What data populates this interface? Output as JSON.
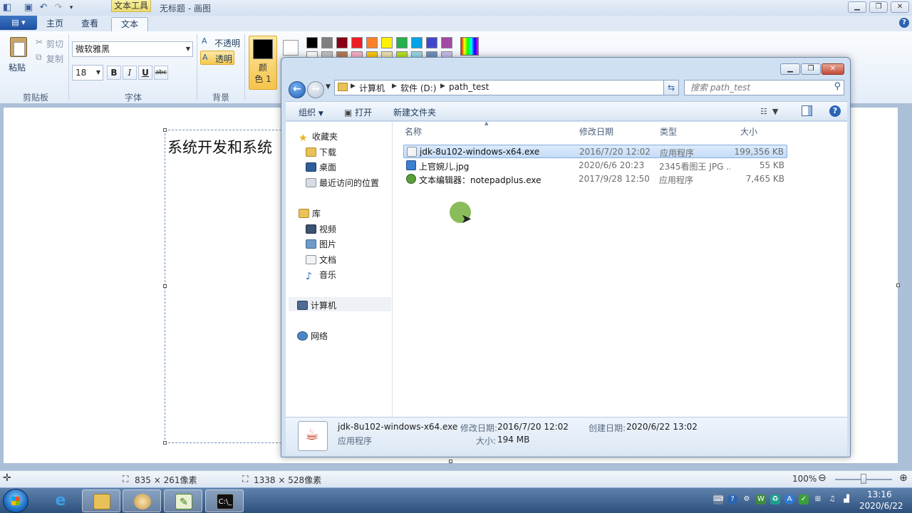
{
  "paint": {
    "title": "无标题 - 画图",
    "context_tab_group": "文本工具",
    "tabs": [
      {
        "label": "主页"
      },
      {
        "label": "查看"
      },
      {
        "label": "文本"
      }
    ],
    "clipboard": {
      "paste": "粘贴",
      "cut": "剪切",
      "copy": "复制",
      "group_label": "剪贴板"
    },
    "font": {
      "family": "微软雅黑",
      "size": "18",
      "bold": "B",
      "italic": "I",
      "underline": "U",
      "strikethrough": "abc",
      "group_label": "字体"
    },
    "background": {
      "opaque": "不透明",
      "transparent": "透明",
      "group_label": "背景"
    },
    "colors": {
      "color1_label_line1": "颜",
      "color1_label_line2": "色 1",
      "palette_row1": [
        "#000000",
        "#7f7f7f",
        "#880015",
        "#ed1c24",
        "#ff7f27",
        "#fff200",
        "#22b14c",
        "#00a2e8",
        "#3f48cc",
        "#a349a4"
      ],
      "palette_row2": [
        "#ffffff",
        "#c3c3c3",
        "#b97a57",
        "#ffaec9",
        "#ffc90e",
        "#efe4b0",
        "#b5e61d",
        "#99d9ea",
        "#7092be",
        "#c8bfe7"
      ]
    },
    "canvas_text": "系统开发和系统",
    "status": {
      "selection_size": "835 × 261像素",
      "canvas_size": "1338 × 528像素",
      "zoom": "100%"
    }
  },
  "explorer": {
    "breadcrumb": [
      "计算机",
      "软件 (D:)",
      "path_test"
    ],
    "search_placeholder": "搜索 path_test",
    "toolbar": {
      "organize": "组织",
      "open": "打开",
      "new_folder": "新建文件夹"
    },
    "nav": {
      "favorites": "收藏夹",
      "downloads": "下载",
      "desktop": "桌面",
      "recent": "最近访问的位置",
      "libraries": "库",
      "videos": "视频",
      "pictures": "图片",
      "documents": "文档",
      "music": "音乐",
      "computer": "计算机",
      "network": "网络"
    },
    "columns": {
      "name": "名称",
      "date": "修改日期",
      "type": "类型",
      "size": "大小"
    },
    "files": [
      {
        "name": "jdk-8u102-windows-x64.exe",
        "date": "2016/7/20 12:02",
        "type": "应用程序",
        "size": "199,356 KB"
      },
      {
        "name": "上官婉儿.jpg",
        "date": "2020/6/6 20:23",
        "type": "2345看图王 JPG ...",
        "size": "55 KB"
      },
      {
        "name": "文本编辑器：notepadplus.exe",
        "date": "2017/9/28 12:50",
        "type": "应用程序",
        "size": "7,465 KB"
      }
    ],
    "details": {
      "name": "jdk-8u102-windows-x64.exe",
      "type": "应用程序",
      "modified_label": "修改日期:",
      "modified_value": "2016/7/20 12:02",
      "created_label": "创建日期:",
      "created_value": "2020/6/22 13:02",
      "size_label": "大小:",
      "size_value": "194 MB"
    }
  },
  "taskbar": {
    "time": "13:16",
    "date": "2020/6/22"
  }
}
